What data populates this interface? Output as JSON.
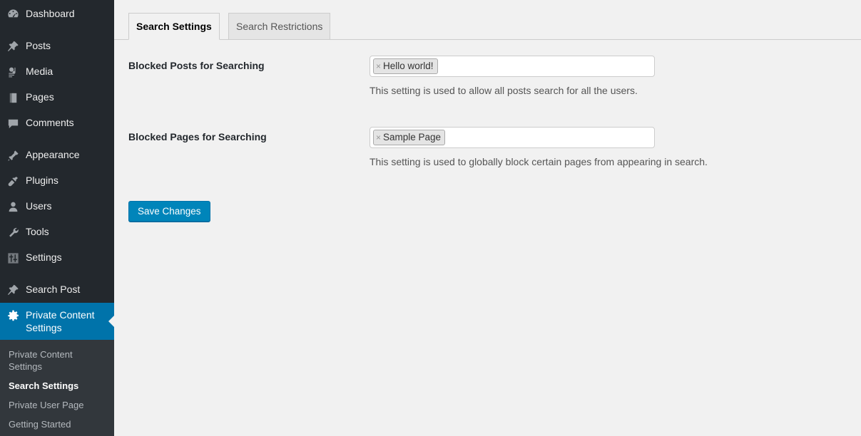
{
  "sidebar": {
    "items": [
      {
        "label": "Dashboard",
        "icon": "dashboard-icon"
      },
      {
        "label": "Posts",
        "icon": "pin-icon"
      },
      {
        "label": "Media",
        "icon": "media-icon"
      },
      {
        "label": "Pages",
        "icon": "pages-icon"
      },
      {
        "label": "Comments",
        "icon": "comments-icon"
      },
      {
        "label": "Appearance",
        "icon": "appearance-icon"
      },
      {
        "label": "Plugins",
        "icon": "plugins-icon"
      },
      {
        "label": "Users",
        "icon": "users-icon"
      },
      {
        "label": "Tools",
        "icon": "tools-icon"
      },
      {
        "label": "Settings",
        "icon": "settings-icon"
      },
      {
        "label": "Search Post",
        "icon": "pin-icon"
      },
      {
        "label": "Private Content Settings",
        "icon": "gear-icon"
      }
    ],
    "active_label": "Private Content Settings",
    "submenu": [
      {
        "label": "Private Content Settings",
        "current": false
      },
      {
        "label": "Search Settings",
        "current": true
      },
      {
        "label": "Private User Page",
        "current": false
      },
      {
        "label": "Getting Started",
        "current": false
      }
    ],
    "colors": {
      "background": "#23282d",
      "submenu_background": "#32373c",
      "active_background": "#0073aa"
    }
  },
  "tabs": [
    {
      "label": "Search Settings",
      "active": true
    },
    {
      "label": "Search Restrictions",
      "active": false
    }
  ],
  "form": {
    "fields": [
      {
        "label": "Blocked Posts for Searching",
        "tokens": [
          {
            "remove": "×",
            "text": "Hello world!"
          }
        ],
        "description": "This setting is used to allow all posts search for all the users."
      },
      {
        "label": "Blocked Pages for Searching",
        "tokens": [
          {
            "remove": "×",
            "text": "Sample Page"
          }
        ],
        "description": "This setting is used to globally block certain pages from appearing in search."
      }
    ],
    "save_label": "Save Changes",
    "save_color": "#0085ba"
  }
}
